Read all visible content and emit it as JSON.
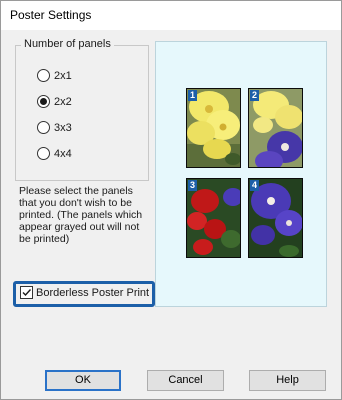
{
  "dialog": {
    "title": "Poster Settings"
  },
  "panels_group": {
    "legend": "Number of panels",
    "options": [
      {
        "label": "2x1",
        "checked": false
      },
      {
        "label": "2x2",
        "checked": true
      },
      {
        "label": "3x3",
        "checked": false
      },
      {
        "label": "4x4",
        "checked": false
      }
    ]
  },
  "instructions": {
    "lines": [
      "Please select the panels",
      "that you don't wish to be",
      "printed. (The panels which",
      "appear grayed out will not",
      "be printed)"
    ]
  },
  "borderless": {
    "label": "Borderless Poster Print",
    "checked": true,
    "highlight_color": "#1c5fa8"
  },
  "preview": {
    "background": "#e6f8fc",
    "panels": [
      {
        "number": "1"
      },
      {
        "number": "2"
      },
      {
        "number": "3"
      },
      {
        "number": "4"
      }
    ]
  },
  "buttons": {
    "ok": "OK",
    "cancel": "Cancel",
    "help": "Help"
  }
}
